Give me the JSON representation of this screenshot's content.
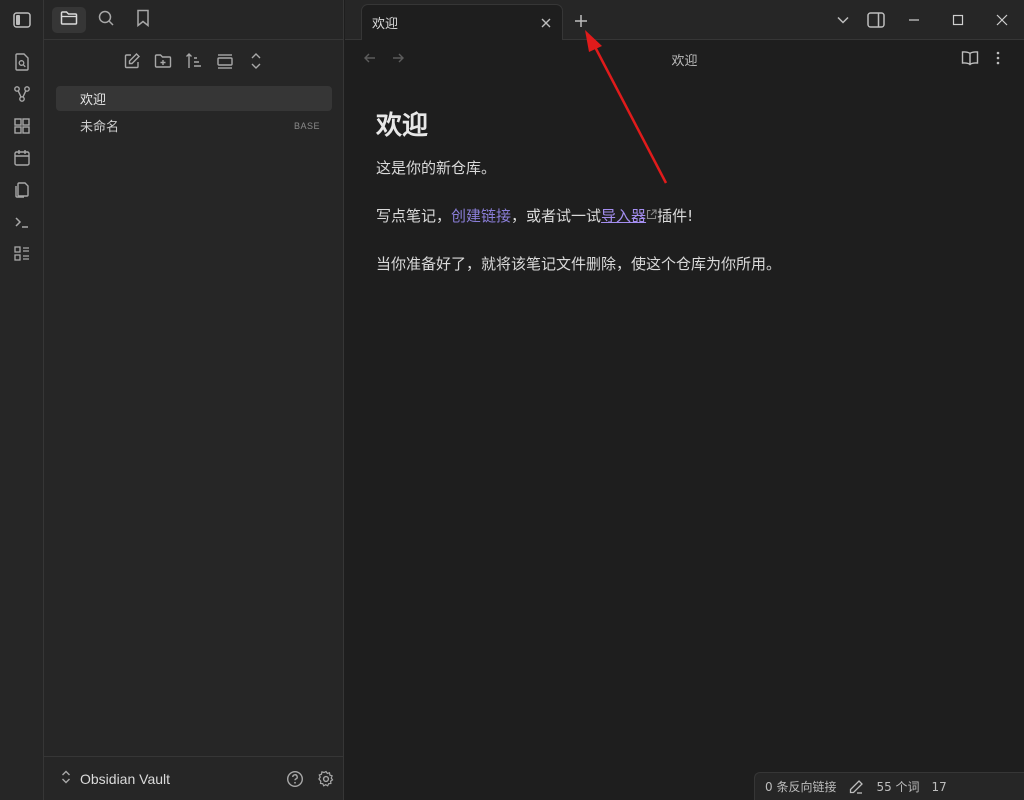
{
  "app": {
    "accent_color": "#8a7ed8",
    "annotation_color": "#e01b1b"
  },
  "ribbon": {
    "toggle_icon": "sidebar-left-icon",
    "items": [
      {
        "icon": "file-search-icon"
      },
      {
        "icon": "graph-icon"
      },
      {
        "icon": "canvas-icon"
      },
      {
        "icon": "calendar-icon"
      },
      {
        "icon": "copy-icon"
      },
      {
        "icon": "terminal-icon"
      },
      {
        "icon": "list-icon"
      }
    ]
  },
  "sidebar": {
    "tabs": [
      {
        "icon": "folder-icon",
        "active": true
      },
      {
        "icon": "search-icon",
        "active": false
      },
      {
        "icon": "bookmark-icon",
        "active": false
      }
    ],
    "nav_buttons": [
      {
        "icon": "new-note-icon"
      },
      {
        "icon": "new-folder-icon"
      },
      {
        "icon": "sort-icon"
      },
      {
        "icon": "collapse-icon"
      },
      {
        "icon": "expand-icon"
      }
    ],
    "files": [
      {
        "name": "欢迎",
        "badge": "",
        "active": true
      },
      {
        "name": "未命名",
        "badge": "BASE",
        "active": false
      }
    ],
    "vault_name": "Obsidian Vault"
  },
  "tabs": [
    {
      "title": "欢迎"
    }
  ],
  "view": {
    "title": "欢迎",
    "heading": "欢迎",
    "para1": "这是你的新仓库。",
    "para2_prefix": "写点笔记，",
    "para2_link": "创建链接",
    "para2_middle": "，或者试一试",
    "para2_ext_link": "导入器",
    "para2_suffix": "插件!",
    "para3": "当你准备好了，就将该笔记文件删除，使这个仓库为你所用。"
  },
  "status_bar": {
    "backlinks": "0 条反向链接",
    "words": "55 个词",
    "chars": "17"
  }
}
